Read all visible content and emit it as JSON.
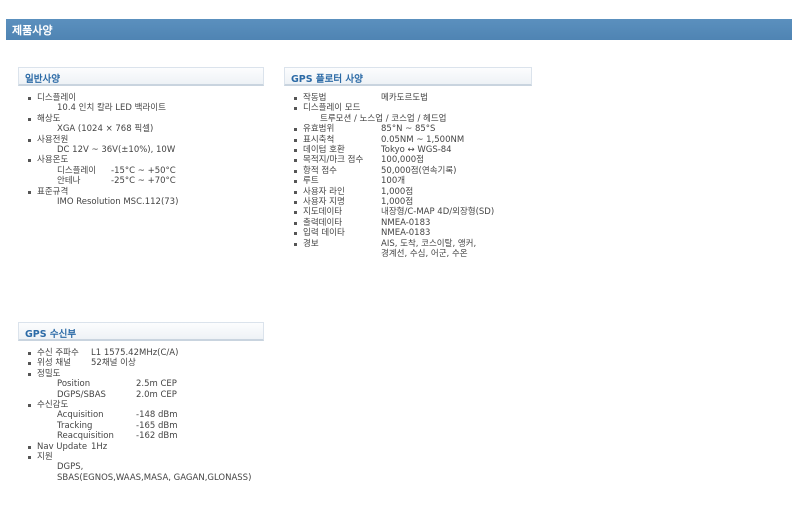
{
  "page_title": "제품사양",
  "general": {
    "title": "일반사양",
    "display_label": "디스플레이",
    "display_value": "10.4 인치 칼라 LED 백라이트",
    "resolution_label": "해상도",
    "resolution_value": "XGA (1024 × 768 픽셀)",
    "power_label": "사용전원",
    "power_value": "DC 12V ~ 36V(±10%), 10W",
    "temp_label": "사용온도",
    "temp_display_label": "디스플레이",
    "temp_display_value": "-15°C ~ +50°C",
    "temp_antenna_label": "안테나",
    "temp_antenna_value": "-25°C ~ +70°C",
    "standard_label": "표준규격",
    "standard_value": "IMO Resolution MSC.112(73)"
  },
  "plotter": {
    "title": "GPS 플로터 사양",
    "rows": [
      {
        "k": "작동법",
        "v": "메카도르도법"
      },
      {
        "k": "디스플레이 모드",
        "v": ""
      },
      {
        "k": "유효범위",
        "v": "85°N ~ 85°S"
      },
      {
        "k": "표시축척",
        "v": "0.05NM ~ 1,500NM"
      },
      {
        "k": "데이텀 호환",
        "v": "Tokyo ↔ WGS-84"
      },
      {
        "k": "목적지/마크 점수",
        "v": "100,000점"
      },
      {
        "k": "항적 점수",
        "v": "50,000점(연속기록)"
      },
      {
        "k": "루트",
        "v": "100개"
      },
      {
        "k": "사용자 라인",
        "v": "1,000점"
      },
      {
        "k": "사용자 지명",
        "v": "1,000점"
      },
      {
        "k": "지도데이타",
        "v": "내장형/C-MAP 4D/외장형(SD)"
      },
      {
        "k": "출력데이타",
        "v": "NMEA-0183"
      },
      {
        "k": "입력 데이타",
        "v": "NMEA-0183"
      },
      {
        "k": "경보",
        "v": "AIS, 도착, 코스이탈, 앵커,"
      }
    ],
    "display_mode_value": "트루모션 / 노스업 / 코스업 / 헤드업",
    "alarm_cont": "경계선, 수심, 어군, 수온"
  },
  "gps": {
    "title": "GPS 수신부",
    "freq_label": "수신 주파수",
    "freq_value": "L1 1575.42MHz(C/A)",
    "channel_label": "위성 채널",
    "channel_value": "52채널 이상",
    "accuracy_label": "정밀도",
    "acc_pos_label": "Position",
    "acc_pos_value": "2.5m CEP",
    "acc_dgps_label": "DGPS/SBAS",
    "acc_dgps_value": "2.0m CEP",
    "sens_label": "수신감도",
    "sens_acq_label": "Acquisition",
    "sens_acq_value": "-148 dBm",
    "sens_trk_label": "Tracking",
    "sens_trk_value": "-165 dBm",
    "sens_reacq_label": "Reacquisition",
    "sens_reacq_value": "-162 dBm",
    "nav_label": "Nav Update",
    "nav_value": "1Hz",
    "support_label": "지원",
    "support_line1": "DGPS,",
    "support_line2": "SBAS(EGNOS,WAAS,MASA, GAGAN,GLONASS)"
  }
}
